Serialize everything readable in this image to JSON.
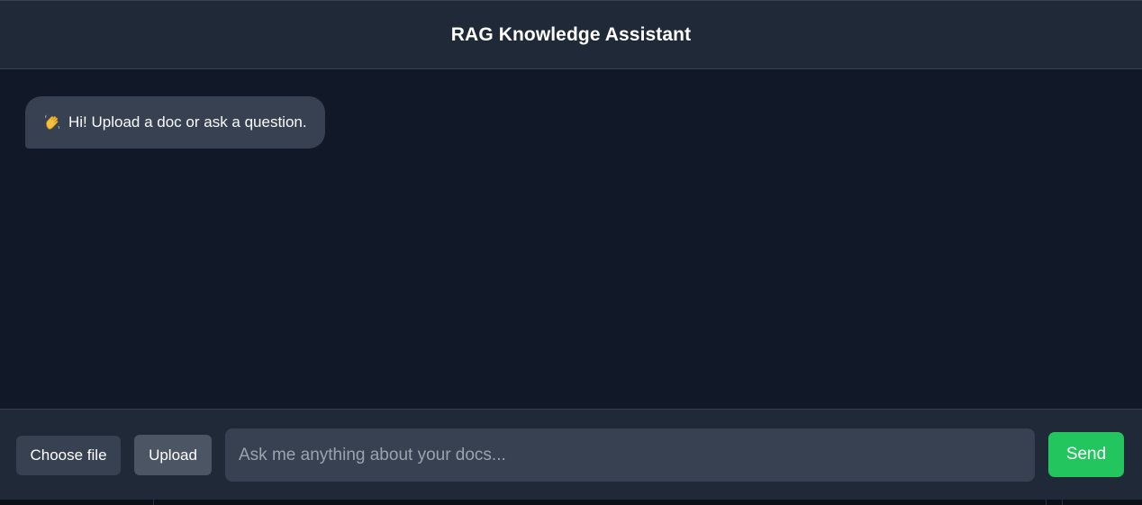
{
  "header": {
    "title": "RAG Knowledge Assistant"
  },
  "chat": {
    "messages": [
      {
        "role": "assistant",
        "icon": "waving-hand-icon",
        "text": "Hi! Upload a doc or ask a question."
      }
    ]
  },
  "composer": {
    "choose_file_label": "Choose file",
    "upload_label": "Upload",
    "input_value": "",
    "input_placeholder": "Ask me anything about your docs...",
    "send_label": "Send"
  },
  "colors": {
    "background": "#111827",
    "panel": "#1f2937",
    "bubble": "#374151",
    "upload_button": "#4b5563",
    "send_button": "#22c55e",
    "placeholder": "#9ca3af"
  }
}
